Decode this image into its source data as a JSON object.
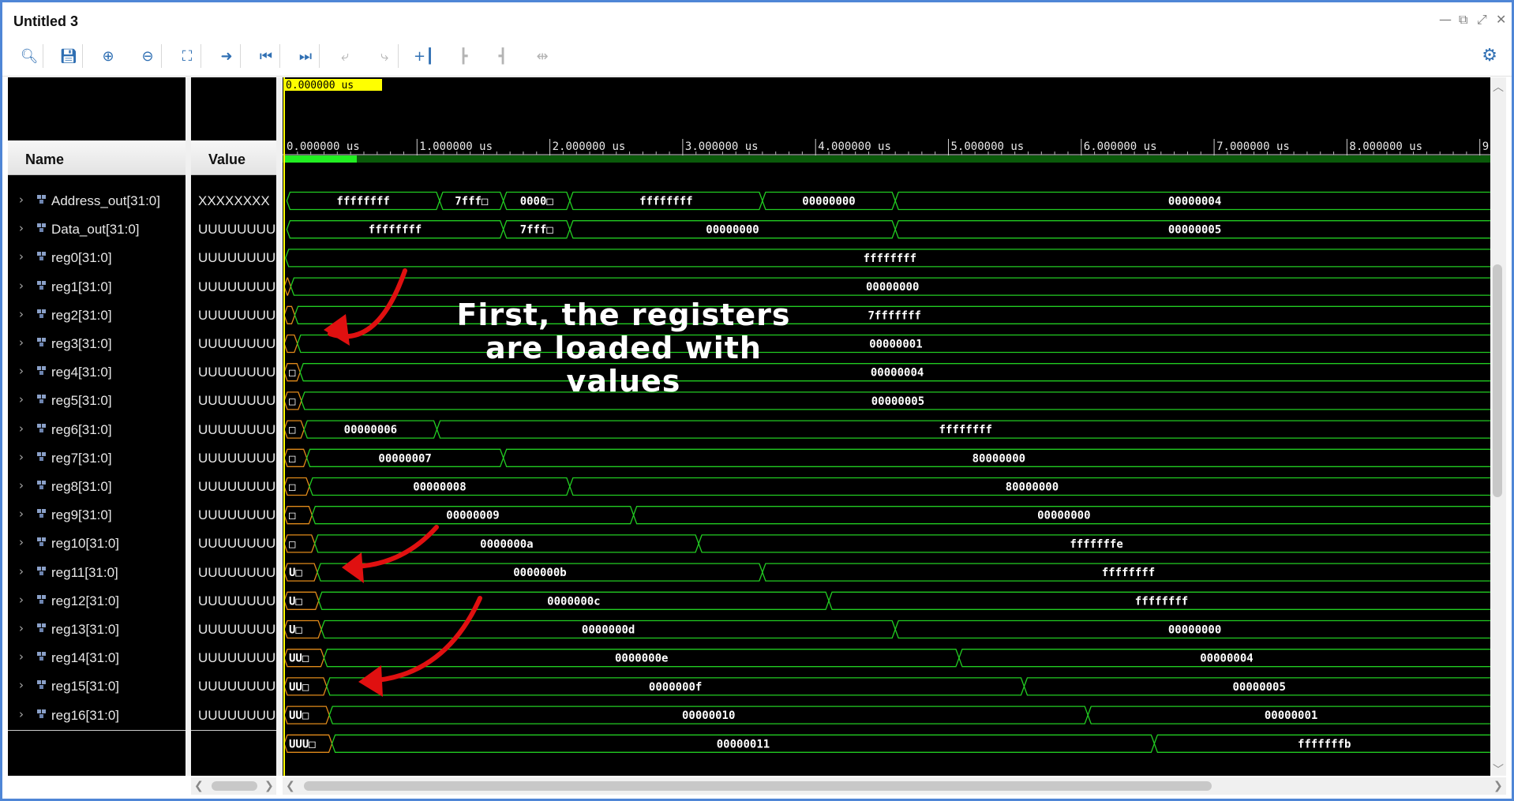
{
  "window": {
    "title": "Untitled 3",
    "controls": [
      "—",
      "⧉",
      "⤢",
      "✕"
    ]
  },
  "toolbar": {
    "buttons": [
      {
        "name": "search-icon",
        "glyph": "🔍︎",
        "enabled": true
      },
      {
        "name": "save-icon",
        "glyph": "💾︎",
        "enabled": true
      },
      {
        "name": "zoom-in-icon",
        "glyph": "⊕",
        "enabled": true
      },
      {
        "name": "zoom-out-icon",
        "glyph": "⊖",
        "enabled": true
      },
      {
        "name": "zoom-fit-icon",
        "glyph": "⛶",
        "enabled": true
      },
      {
        "name": "go-to-cursor-icon",
        "glyph": "➜",
        "enabled": true
      },
      {
        "name": "go-to-time-zero-icon",
        "glyph": "⏮",
        "enabled": true
      },
      {
        "name": "go-to-last-time-icon",
        "glyph": "⏭",
        "enabled": true
      },
      {
        "name": "previous-transition-icon",
        "glyph": "⤶",
        "enabled": false
      },
      {
        "name": "next-transition-icon",
        "glyph": "⤷",
        "enabled": false
      },
      {
        "name": "add-marker-icon",
        "glyph": "+┃",
        "enabled": true
      },
      {
        "name": "previous-marker-icon",
        "glyph": "┣",
        "enabled": false
      },
      {
        "name": "next-marker-icon",
        "glyph": "┫",
        "enabled": false
      },
      {
        "name": "swap-cursors-icon",
        "glyph": "⇹",
        "enabled": false
      }
    ],
    "settings_icon": "⚙"
  },
  "columns": {
    "name": "Name",
    "value": "Value"
  },
  "cursor": {
    "time_label": "0.000000 us",
    "time_us": 0
  },
  "timeline": {
    "unit": "us",
    "tick_labels": [
      "0.000000 us",
      "1.000000 us",
      "2.000000 us",
      "3.000000 us",
      "4.000000 us",
      "5.000000 us",
      "6.000000 us",
      "7.000000 us",
      "8.000000 us",
      "9."
    ],
    "range_us": [
      0,
      9.1
    ]
  },
  "signals": [
    {
      "name": "Address_out[31:0]",
      "value": "XXXXXXXX",
      "segments": [
        {
          "start": 0.02,
          "label": "ffffffff"
        },
        {
          "start": 1.17,
          "label": "7fff□"
        },
        {
          "start": 1.65,
          "label": "0000□"
        },
        {
          "start": 2.15,
          "label": "ffffffff"
        },
        {
          "start": 3.6,
          "label": "00000000"
        },
        {
          "start": 4.6,
          "label": "00000004"
        }
      ]
    },
    {
      "name": "Data_out[31:0]",
      "value": "UUUUUUUU",
      "segments": [
        {
          "start": 0.02,
          "label": "ffffffff"
        },
        {
          "start": 1.65,
          "label": "7fff□"
        },
        {
          "start": 2.15,
          "label": "00000000"
        },
        {
          "start": 4.6,
          "label": "00000005"
        }
      ]
    },
    {
      "name": "reg0[31:0]",
      "value": "UUUUUUUU",
      "segments": [
        {
          "start": 0.01,
          "label": "ffffffff"
        }
      ]
    },
    {
      "name": "reg1[31:0]",
      "value": "UUUUUUUU",
      "segments": [
        {
          "start": 0,
          "label": ""
        },
        {
          "start": 0.05,
          "label": "00000000"
        }
      ]
    },
    {
      "name": "reg2[31:0]",
      "value": "UUUUUUUU",
      "segments": [
        {
          "start": 0,
          "label": ""
        },
        {
          "start": 0.08,
          "label": "7fffffff"
        }
      ]
    },
    {
      "name": "reg3[31:0]",
      "value": "UUUUUUUU",
      "segments": [
        {
          "start": 0,
          "label": ""
        },
        {
          "start": 0.1,
          "label": "00000001"
        }
      ]
    },
    {
      "name": "reg4[31:0]",
      "value": "UUUUUUUU",
      "segments": [
        {
          "start": 0,
          "label": "□"
        },
        {
          "start": 0.12,
          "label": "00000004"
        }
      ]
    },
    {
      "name": "reg5[31:0]",
      "value": "UUUUUUUU",
      "segments": [
        {
          "start": 0,
          "label": "□"
        },
        {
          "start": 0.13,
          "label": "00000005"
        }
      ]
    },
    {
      "name": "reg6[31:0]",
      "value": "UUUUUUUU",
      "segments": [
        {
          "start": 0,
          "label": "□"
        },
        {
          "start": 0.15,
          "label": "00000006"
        },
        {
          "start": 1.15,
          "label": "ffffffff"
        }
      ]
    },
    {
      "name": "reg7[31:0]",
      "value": "UUUUUUUU",
      "segments": [
        {
          "start": 0,
          "label": "□"
        },
        {
          "start": 0.17,
          "label": "00000007"
        },
        {
          "start": 1.65,
          "label": "80000000"
        }
      ]
    },
    {
      "name": "reg8[31:0]",
      "value": "UUUUUUUU",
      "segments": [
        {
          "start": 0,
          "label": "□"
        },
        {
          "start": 0.19,
          "label": "00000008"
        },
        {
          "start": 2.15,
          "label": "80000000"
        }
      ]
    },
    {
      "name": "reg9[31:0]",
      "value": "UUUUUUUU",
      "segments": [
        {
          "start": 0,
          "label": "□"
        },
        {
          "start": 0.21,
          "label": "00000009"
        },
        {
          "start": 2.63,
          "label": "00000000"
        }
      ]
    },
    {
      "name": "reg10[31:0]",
      "value": "UUUUUUUU",
      "segments": [
        {
          "start": 0,
          "label": "□"
        },
        {
          "start": 0.23,
          "label": "0000000a"
        },
        {
          "start": 3.12,
          "label": "fffffffe"
        }
      ]
    },
    {
      "name": "reg11[31:0]",
      "value": "UUUUUUUU",
      "segments": [
        {
          "start": 0,
          "label": "U□"
        },
        {
          "start": 0.25,
          "label": "0000000b"
        },
        {
          "start": 3.6,
          "label": "ffffffff"
        }
      ]
    },
    {
      "name": "reg12[31:0]",
      "value": "UUUUUUUU",
      "segments": [
        {
          "start": 0,
          "label": "U□"
        },
        {
          "start": 0.26,
          "label": "0000000c"
        },
        {
          "start": 4.1,
          "label": "ffffffff"
        }
      ]
    },
    {
      "name": "reg13[31:0]",
      "value": "UUUUUUUU",
      "segments": [
        {
          "start": 0,
          "label": "U□"
        },
        {
          "start": 0.28,
          "label": "0000000d"
        },
        {
          "start": 4.6,
          "label": "00000000"
        }
      ]
    },
    {
      "name": "reg14[31:0]",
      "value": "UUUUUUUU",
      "segments": [
        {
          "start": 0,
          "label": "UU□"
        },
        {
          "start": 0.3,
          "label": "0000000e"
        },
        {
          "start": 5.08,
          "label": "00000004"
        }
      ]
    },
    {
      "name": "reg15[31:0]",
      "value": "UUUUUUUU",
      "segments": [
        {
          "start": 0,
          "label": "UU□"
        },
        {
          "start": 0.32,
          "label": "0000000f"
        },
        {
          "start": 5.57,
          "label": "00000005"
        }
      ]
    },
    {
      "name": "reg16[31:0]",
      "value": "UUUUUUUU",
      "segments": [
        {
          "start": 0,
          "label": "UU□"
        },
        {
          "start": 0.34,
          "label": "00000010"
        },
        {
          "start": 6.05,
          "label": "00000001"
        }
      ]
    },
    {
      "name": "",
      "value": "",
      "segments": [
        {
          "start": 0,
          "label": "UUU□"
        },
        {
          "start": 0.36,
          "label": "00000011"
        },
        {
          "start": 6.55,
          "label": "fffffffb"
        }
      ]
    }
  ],
  "annotation": {
    "text_lines": [
      "First, the registers",
      "are loaded with",
      "values"
    ],
    "arrow_color": "#e01010"
  },
  "colors": {
    "wave": "#22cc22",
    "wave_bg": "#000000",
    "cursor": "#ffff00",
    "frame": "#4f86d6",
    "accent": "#2f6fb3"
  }
}
